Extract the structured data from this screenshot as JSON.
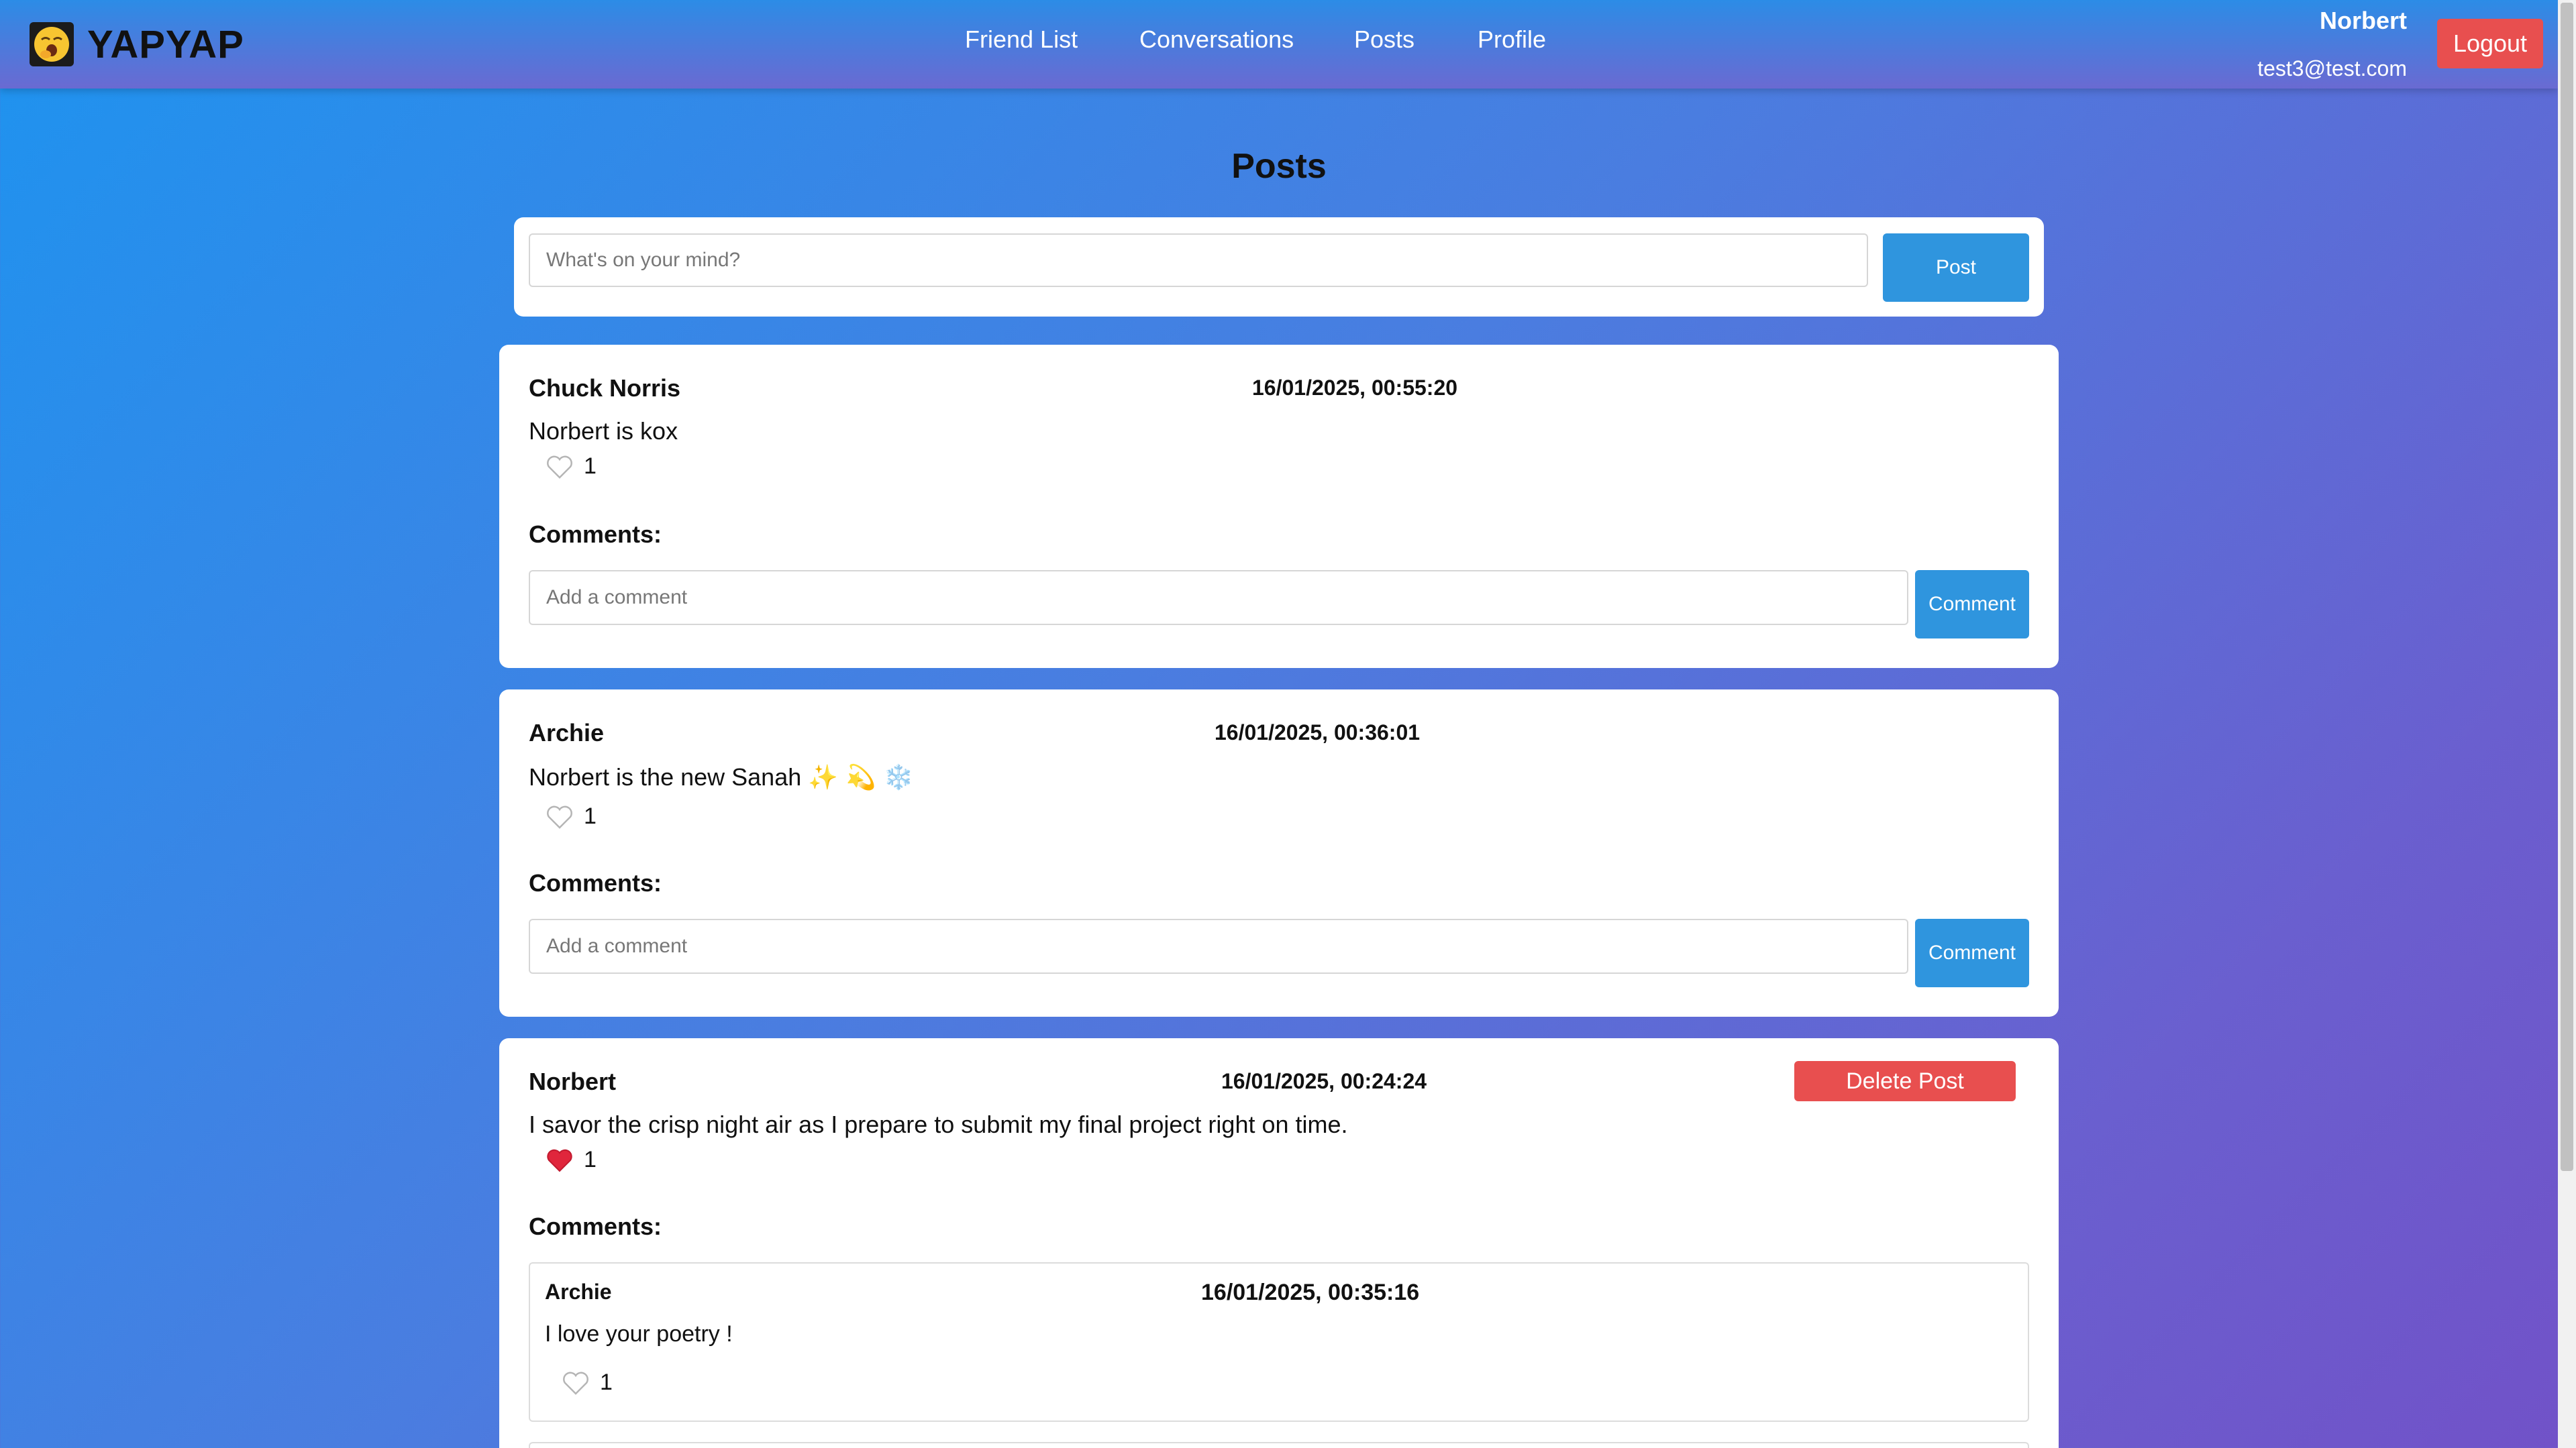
{
  "header": {
    "app_name": "YAPYAP",
    "nav": [
      {
        "label": "Friend List"
      },
      {
        "label": "Conversations"
      },
      {
        "label": "Posts"
      },
      {
        "label": "Profile"
      }
    ],
    "user_name": "Norbert",
    "user_email": "test3@test.com",
    "logout_label": "Logout"
  },
  "page_title": "Posts",
  "composer": {
    "placeholder": "What's on your mind?",
    "post_label": "Post"
  },
  "posts": [
    {
      "author": "Chuck Norris",
      "date": "16/01/2025, 00:55:20",
      "content": "Norbert is kox",
      "likes": "1",
      "liked": false,
      "comments_title": "Comments:",
      "comment_placeholder": "Add a comment",
      "comment_label": "Comment"
    },
    {
      "author": "Archie",
      "date": "16/01/2025, 00:36:01",
      "content": "Norbert is the new Sanah",
      "content_emoji": "✨ 💫 ❄️",
      "likes": "1",
      "liked": false,
      "comments_title": "Comments:",
      "comment_placeholder": "Add a comment",
      "comment_label": "Comment"
    },
    {
      "author": "Norbert",
      "date": "16/01/2025, 00:24:24",
      "delete_label": "Delete Post",
      "content": "I savor the crisp night air as I prepare to submit my final project right on time.",
      "likes": "1",
      "liked": true,
      "comments_title": "Comments:",
      "comments": [
        {
          "author": "Archie",
          "date": "16/01/2025, 00:35:16",
          "content": "I love your poetry !",
          "likes": "1"
        }
      ]
    }
  ],
  "colors": {
    "accent_blue": "#2f95de",
    "danger_red": "#e84f4f",
    "liked_heart": "#e0263c"
  }
}
